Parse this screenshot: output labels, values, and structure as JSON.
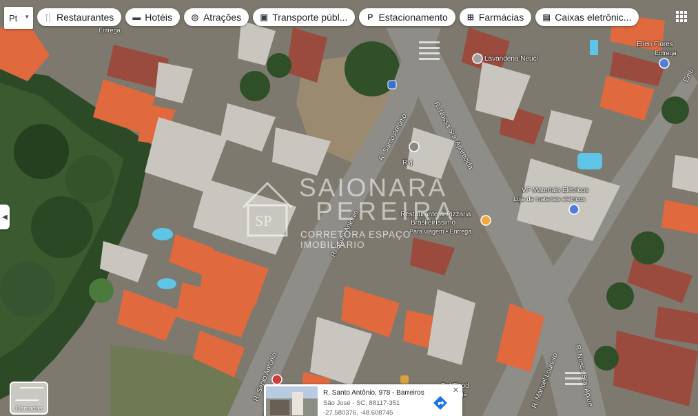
{
  "language_selector": {
    "label": "Pt"
  },
  "chips": [
    {
      "icon": "restaurant-icon",
      "glyph": "🍴",
      "label": "Restaurantes"
    },
    {
      "icon": "hotel-icon",
      "glyph": "▬",
      "label": "Hotéis"
    },
    {
      "icon": "attraction-icon",
      "glyph": "◎",
      "label": "Atrações"
    },
    {
      "icon": "transit-icon",
      "glyph": "▣",
      "label": "Transporte públ..."
    },
    {
      "icon": "parking-icon",
      "glyph": "P",
      "label": "Estacionamento"
    },
    {
      "icon": "pharmacy-icon",
      "glyph": "⊞",
      "label": "Farmácias"
    },
    {
      "icon": "atm-icon",
      "glyph": "▤",
      "label": "Caixas eletrônic..."
    }
  ],
  "map_labels": {
    "lavanderia": "Lavanderia Neuci",
    "ellen": "Ellen Flores",
    "ellen_sub": "Entrega",
    "emb": "Emb",
    "rvj": "Rvj",
    "vf": "VF Materiais Elétricos",
    "vf_sub": "Loja de materiais elétricos",
    "restaurante": "Restaurante & Pizzaria",
    "restaurante2": "Brasileiríssimo",
    "restaurante_sub": "Para viagem • Entrega",
    "entrega_top": "Entrega",
    "petfood": "Pet Food",
    "petfood_sub": "Entrega",
    "street_santo1": "R. Santo Antônio",
    "street_santo2": "R. Santo Antônio",
    "street_santo3": "R. Santo Antônio",
    "street_aparecida1": "R. Nossa Sra. Aparecida",
    "street_aparecida2": "R. Nossa Sra. Apare",
    "street_loureiro": "R. Manoel Loureiro"
  },
  "watermark": {
    "line1": "SAIONARA",
    "line2": "PEREIRA",
    "line3": "CORRETORA ESPAÇO IMOBILIÁRIO",
    "monogram": "SP"
  },
  "layers_button": {
    "label": "Camadas"
  },
  "info_card": {
    "address": "R. Santo Antônio, 978 - Barreiros",
    "city": "São José - SC, 88117-351",
    "coords": "-27.580376, -48.608745"
  },
  "colors": {
    "roof_orange": "#e0693e",
    "road": "#8e8d88",
    "tree": "#2f4a2a",
    "pool": "#5ec4e8"
  }
}
